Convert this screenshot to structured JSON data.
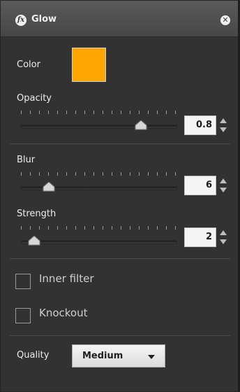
{
  "panel": {
    "title": "Glow",
    "fx_icon_glyph": "fx",
    "close_glyph": "✕"
  },
  "color": {
    "label": "Color",
    "value": "#FFA500"
  },
  "opacity": {
    "label": "Opacity",
    "value": "0.8",
    "slider_fraction": 0.8
  },
  "blur": {
    "label": "Blur",
    "value": "6",
    "slider_fraction": 0.15
  },
  "strength": {
    "label": "Strength",
    "value": "2",
    "slider_fraction": 0.05
  },
  "options": {
    "inner_filter_label": "Inner filter",
    "inner_filter_checked": false,
    "knockout_label": "Knockout",
    "knockout_checked": false
  },
  "quality": {
    "label": "Quality",
    "selected": "Medium"
  },
  "icons": {
    "title": "fx-icon",
    "close": "close-icon",
    "spinner": "spinner-arrows-icon",
    "dropdown": "chevron-down-icon"
  }
}
